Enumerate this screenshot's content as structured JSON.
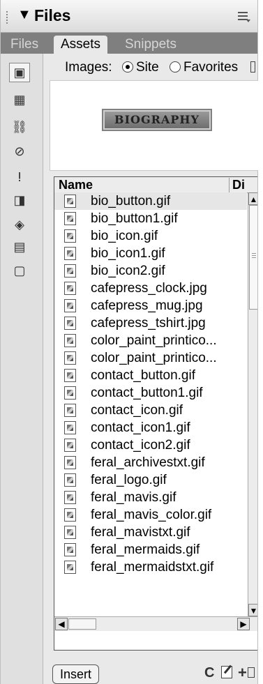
{
  "panel": {
    "title": "Files",
    "collapse_glyph": "▼",
    "options_icon": "options-menu-icon"
  },
  "tabs": [
    {
      "label": "Files",
      "active": false
    },
    {
      "label": "Assets",
      "active": true
    },
    {
      "label": "Snippets",
      "active": false
    }
  ],
  "categories": [
    {
      "name": "images-icon",
      "glyph": "▣",
      "selected": true
    },
    {
      "name": "colors-icon",
      "glyph": "▦",
      "selected": false
    },
    {
      "name": "urls-icon",
      "glyph": "⛓",
      "selected": false
    },
    {
      "name": "flash-icon",
      "glyph": "⊘",
      "selected": false
    },
    {
      "name": "shockwave-icon",
      "glyph": "ⵑ",
      "selected": false
    },
    {
      "name": "movies-icon",
      "glyph": "◨",
      "selected": false
    },
    {
      "name": "scripts-icon",
      "glyph": "◈",
      "selected": false
    },
    {
      "name": "templates-icon",
      "glyph": "▤",
      "selected": false
    },
    {
      "name": "library-icon",
      "glyph": "▢",
      "selected": false
    }
  ],
  "assets": {
    "images_label": "Images:",
    "site_label": "Site",
    "favorites_label": "Favorites",
    "selected_scope": "Site",
    "preview_text": "BIOGRAPHY"
  },
  "list": {
    "col_name": "Name",
    "col_dim": "Di",
    "files": [
      "bio_button.gif",
      "bio_button1.gif",
      "bio_icon.gif",
      "bio_icon1.gif",
      "bio_icon2.gif",
      "cafepress_clock.jpg",
      "cafepress_mug.jpg",
      "cafepress_tshirt.jpg",
      "color_paint_printico...",
      "color_paint_printico...",
      "contact_button.gif",
      "contact_button1.gif",
      "contact_icon.gif",
      "contact_icon1.gif",
      "contact_icon2.gif",
      "feral_archivestxt.gif",
      "feral_logo.gif",
      "feral_mavis.gif",
      "feral_mavis_color.gif",
      "feral_mavistxt.gif",
      "feral_mermaids.gif",
      "feral_mermaidstxt.gif"
    ],
    "selected_index": 0
  },
  "footer": {
    "insert_label": "Insert",
    "refresh_glyph": "C",
    "add_glyph": "+"
  }
}
